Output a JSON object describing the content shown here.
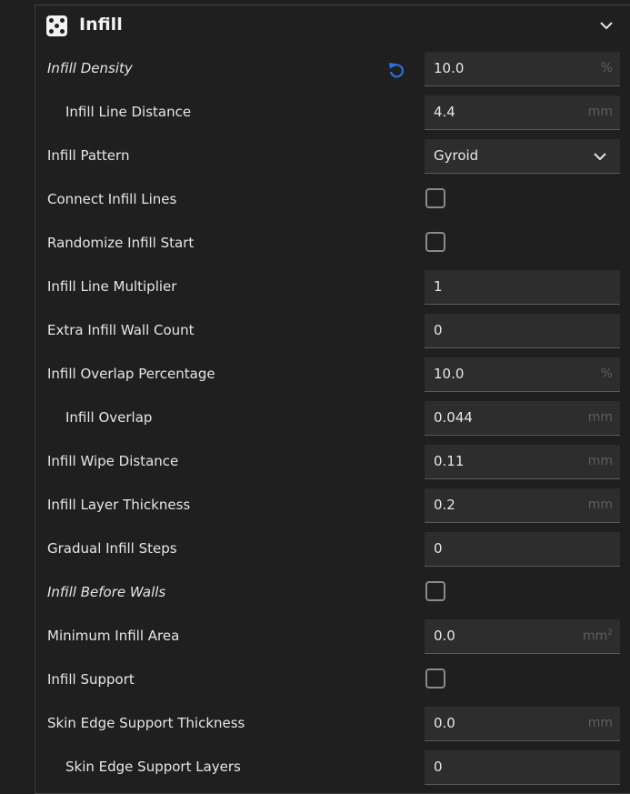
{
  "header": {
    "title": "Infill",
    "icon": "infill-pattern-icon",
    "collapse_icon": "chevron-down-icon"
  },
  "colors": {
    "background": "#1f1f1f",
    "field": "#2d2d2d",
    "accent": "#2a6fdb",
    "unit": "#5e5e5e"
  },
  "settings": [
    {
      "label": "Infill Density",
      "type": "number",
      "value": "10.0",
      "unit": "%",
      "italic": true,
      "indent": false,
      "reset": true
    },
    {
      "label": "Infill Line Distance",
      "type": "number",
      "value": "4.4",
      "unit": "mm",
      "indent": true
    },
    {
      "label": "Infill Pattern",
      "type": "select",
      "value": "Gyroid"
    },
    {
      "label": "Connect Infill Lines",
      "type": "checkbox",
      "checked": false
    },
    {
      "label": "Randomize Infill Start",
      "type": "checkbox",
      "checked": false
    },
    {
      "label": "Infill Line Multiplier",
      "type": "number",
      "value": "1",
      "unit": ""
    },
    {
      "label": "Extra Infill Wall Count",
      "type": "number",
      "value": "0",
      "unit": ""
    },
    {
      "label": "Infill Overlap Percentage",
      "type": "number",
      "value": "10.0",
      "unit": "%"
    },
    {
      "label": "Infill Overlap",
      "type": "number",
      "value": "0.044",
      "unit": "mm",
      "indent": true
    },
    {
      "label": "Infill Wipe Distance",
      "type": "number",
      "value": "0.11",
      "unit": "mm"
    },
    {
      "label": "Infill Layer Thickness",
      "type": "number",
      "value": "0.2",
      "unit": "mm"
    },
    {
      "label": "Gradual Infill Steps",
      "type": "number",
      "value": "0",
      "unit": ""
    },
    {
      "label": "Infill Before Walls",
      "type": "checkbox",
      "checked": false,
      "italic": true
    },
    {
      "label": "Minimum Infill Area",
      "type": "number",
      "value": "0.0",
      "unit": "mm",
      "unit_sup": "2"
    },
    {
      "label": "Infill Support",
      "type": "checkbox",
      "checked": false
    },
    {
      "label": "Skin Edge Support Thickness",
      "type": "number",
      "value": "0.0",
      "unit": "mm"
    },
    {
      "label": "Skin Edge Support Layers",
      "type": "number",
      "value": "0",
      "unit": "",
      "indent": true
    }
  ]
}
